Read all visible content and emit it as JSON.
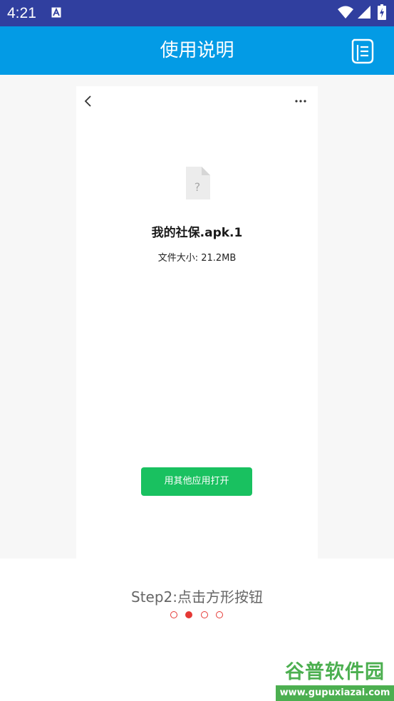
{
  "status_bar": {
    "time": "4:21",
    "icons": [
      "a-notification-icon",
      "wifi-icon",
      "signal-icon",
      "battery-icon"
    ]
  },
  "app_bar": {
    "title": "使用说明",
    "action_icon": "document-list-icon"
  },
  "screenshot": {
    "file_name": "我的社保.apk.1",
    "file_size": "文件大小: 21.2MB",
    "open_button": "用其他应用打开",
    "icons": [
      "back-icon",
      "more-icon",
      "unknown-file-icon"
    ]
  },
  "guide": {
    "step_text": "Step2:点击方形按钮",
    "pages": 4,
    "current_page": 2
  },
  "watermark": {
    "brand": "谷普软件园",
    "url": "www.gupuxiazai.com"
  },
  "colors": {
    "status_bar": "#303f9f",
    "app_bar": "#039be5",
    "button_green": "#19c160",
    "indicator_red": "#e53935"
  }
}
